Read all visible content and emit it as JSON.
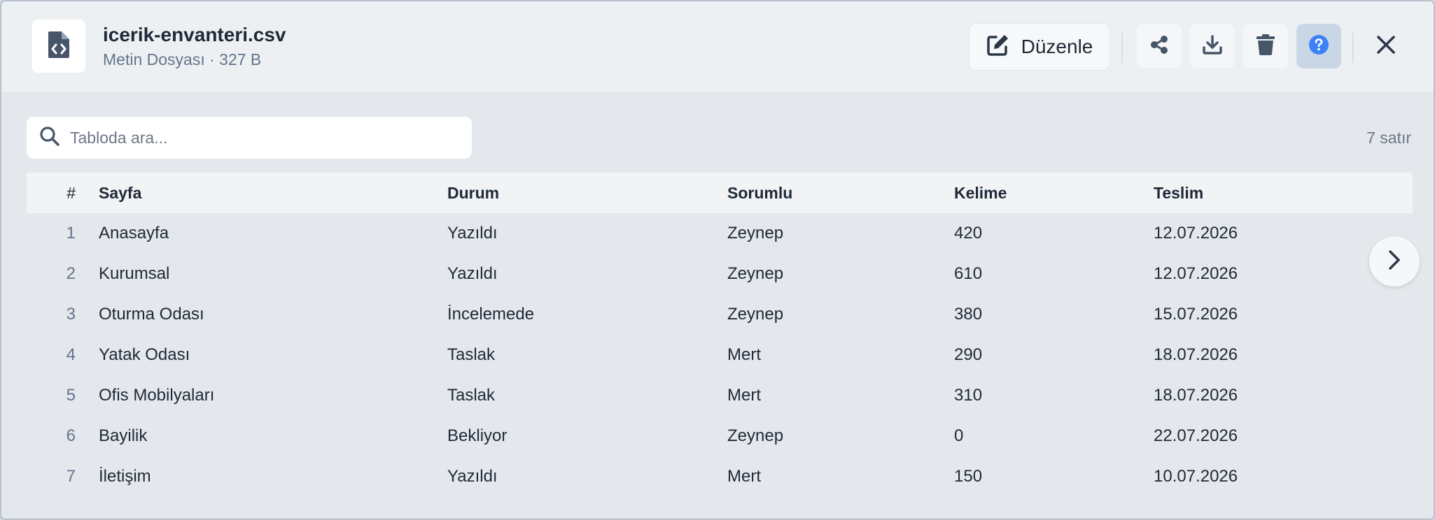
{
  "file": {
    "name": "icerik-envanteri.csv",
    "meta": "Metin Dosyası · 327 B",
    "icon": "file-code-icon"
  },
  "toolbar": {
    "edit_label": "Düzenle",
    "icons": [
      "edit-icon",
      "share-icon",
      "download-icon",
      "trash-icon",
      "help-icon",
      "close-icon"
    ]
  },
  "search": {
    "placeholder": "Tabloda ara...",
    "value": ""
  },
  "row_count": "7 satır",
  "table": {
    "columns": [
      "#",
      "Sayfa",
      "Durum",
      "Sorumlu",
      "Kelime",
      "Teslim"
    ],
    "rows": [
      [
        "1",
        "Anasayfa",
        "Yazıldı",
        "Zeynep",
        "420",
        "12.07.2026"
      ],
      [
        "2",
        "Kurumsal",
        "Yazıldı",
        "Zeynep",
        "610",
        "12.07.2026"
      ],
      [
        "3",
        "Oturma Odası",
        "İncelemede",
        "Zeynep",
        "380",
        "15.07.2026"
      ],
      [
        "4",
        "Yatak Odası",
        "Taslak",
        "Mert",
        "290",
        "18.07.2026"
      ],
      [
        "5",
        "Ofis Mobilyaları",
        "Taslak",
        "Mert",
        "310",
        "18.07.2026"
      ],
      [
        "6",
        "Bayilik",
        "Bekliyor",
        "Zeynep",
        "0",
        "22.07.2026"
      ],
      [
        "7",
        "İletişim",
        "Yazıldı",
        "Mert",
        "150",
        "10.07.2026"
      ]
    ]
  },
  "colors": {
    "accent": "#3b82f6",
    "text": "#1f2937",
    "muted": "#64748b"
  }
}
